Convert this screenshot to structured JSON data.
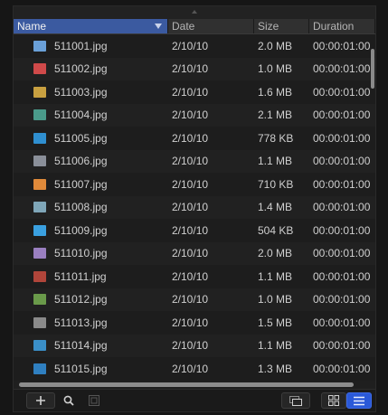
{
  "columns": {
    "name": "Name",
    "date": "Date",
    "size": "Size",
    "duration": "Duration"
  },
  "files": [
    {
      "name": "511001.jpg",
      "date": "2/10/10",
      "size": "2.0 MB",
      "duration": "00:00:01:00",
      "thumb_color": "#6aa0d8"
    },
    {
      "name": "511002.jpg",
      "date": "2/10/10",
      "size": "1.0 MB",
      "duration": "00:00:01:00",
      "thumb_color": "#d04a4a"
    },
    {
      "name": "511003.jpg",
      "date": "2/10/10",
      "size": "1.6 MB",
      "duration": "00:00:01:00",
      "thumb_color": "#c8a040"
    },
    {
      "name": "511004.jpg",
      "date": "2/10/10",
      "size": "2.1 MB",
      "duration": "00:00:01:00",
      "thumb_color": "#4a9a8a"
    },
    {
      "name": "511005.jpg",
      "date": "2/10/10",
      "size": "778 KB",
      "duration": "00:00:01:00",
      "thumb_color": "#2f8fd0"
    },
    {
      "name": "511006.jpg",
      "date": "2/10/10",
      "size": "1.1 MB",
      "duration": "00:00:01:00",
      "thumb_color": "#8a8f99"
    },
    {
      "name": "511007.jpg",
      "date": "2/10/10",
      "size": "710 KB",
      "duration": "00:00:01:00",
      "thumb_color": "#e08a3a"
    },
    {
      "name": "511008.jpg",
      "date": "2/10/10",
      "size": "1.4 MB",
      "duration": "00:00:01:00",
      "thumb_color": "#7fa6b8"
    },
    {
      "name": "511009.jpg",
      "date": "2/10/10",
      "size": "504 KB",
      "duration": "00:00:01:00",
      "thumb_color": "#3aa0e0"
    },
    {
      "name": "511010.jpg",
      "date": "2/10/10",
      "size": "2.0 MB",
      "duration": "00:00:01:00",
      "thumb_color": "#9a7fc0"
    },
    {
      "name": "511011.jpg",
      "date": "2/10/10",
      "size": "1.1 MB",
      "duration": "00:00:01:00",
      "thumb_color": "#b0453a"
    },
    {
      "name": "511012.jpg",
      "date": "2/10/10",
      "size": "1.0 MB",
      "duration": "00:00:01:00",
      "thumb_color": "#6a9a4a"
    },
    {
      "name": "511013.jpg",
      "date": "2/10/10",
      "size": "1.5 MB",
      "duration": "00:00:01:00",
      "thumb_color": "#8a8a8a"
    },
    {
      "name": "511014.jpg",
      "date": "2/10/10",
      "size": "1.1 MB",
      "duration": "00:00:01:00",
      "thumb_color": "#3a8fc8"
    },
    {
      "name": "511015.jpg",
      "date": "2/10/10",
      "size": "1.3 MB",
      "duration": "00:00:01:00",
      "thumb_color": "#2f7fc0"
    }
  ],
  "toolbar": {
    "add_icon": "plus-icon",
    "search_icon": "search-icon",
    "import_icon": "import-icon",
    "preview_icon": "preview-icon",
    "grid_view_icon": "grid-view-icon",
    "list_view_icon": "list-view-icon",
    "active_view": "list",
    "accent_color": "#2a59d8"
  }
}
